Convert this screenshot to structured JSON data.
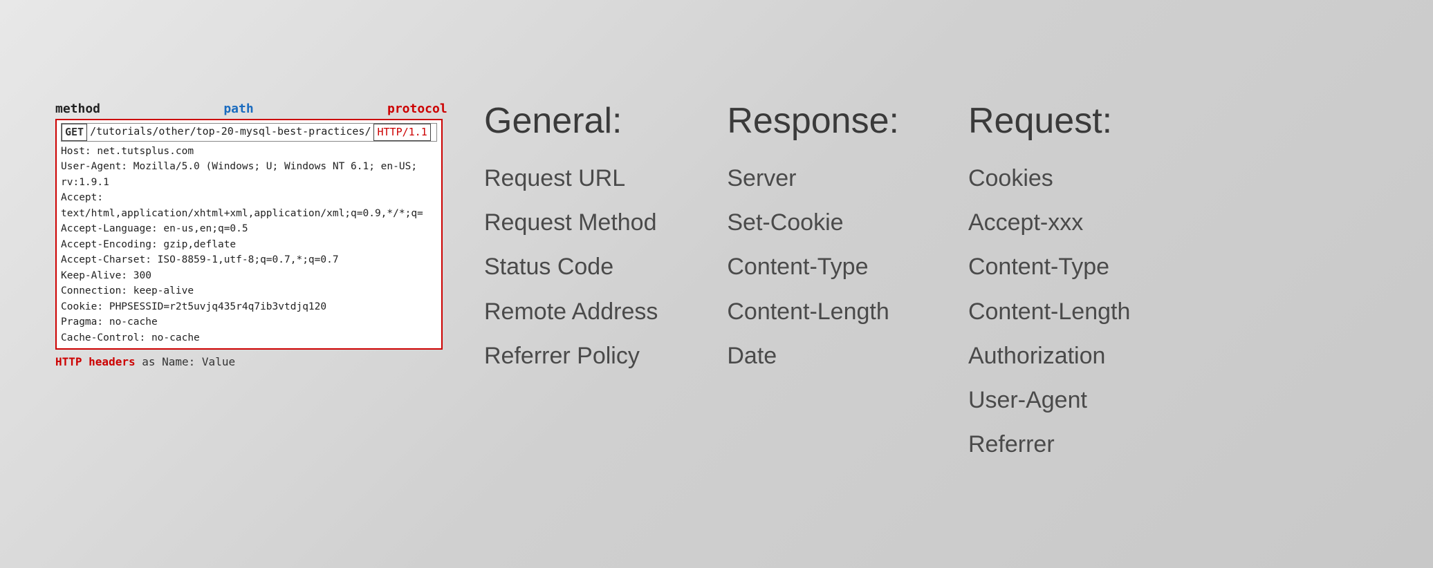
{
  "http_panel": {
    "labels": {
      "method": "method",
      "path": "path",
      "protocol": "protocol"
    },
    "request_line": {
      "method": "GET",
      "path": "/tutorials/other/top-20-mysql-best-practices/",
      "protocol": "HTTP/1.1"
    },
    "headers": [
      "Host: net.tutsplus.com",
      "User-Agent: Mozilla/5.0 (Windows; U; Windows NT 6.1; en-US; rv:1.9.1",
      "Accept: text/html,application/xhtml+xml,application/xml;q=0.9,*/*;q=",
      "Accept-Language: en-us,en;q=0.5",
      "Accept-Encoding: gzip,deflate",
      "Accept-Charset: ISO-8859-1,utf-8;q=0.7,*;q=0.7",
      "Keep-Alive: 300",
      "Connection: keep-alive",
      "Cookie: PHPSESSID=r2t5uvjq435r4q7ib3vtdjq120",
      "Pragma: no-cache",
      "Cache-Control: no-cache"
    ],
    "caption_normal": " as Name: Value",
    "caption_highlight": "HTTP headers"
  },
  "columns": [
    {
      "id": "general",
      "title": "General:",
      "items": [
        "Request URL",
        "Request Method",
        "Status Code",
        "Remote Address",
        "Referrer Policy"
      ]
    },
    {
      "id": "response",
      "title": "Response:",
      "items": [
        "Server",
        "Set-Cookie",
        "Content-Type",
        "Content-Length",
        "Date"
      ]
    },
    {
      "id": "request",
      "title": "Request:",
      "items": [
        "Cookies",
        "Accept-xxx",
        "Content-Type",
        "Content-Length",
        "Authorization",
        "User-Agent",
        "Referrer"
      ]
    }
  ]
}
